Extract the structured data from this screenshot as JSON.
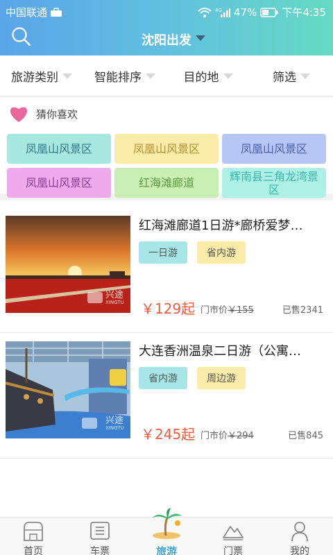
{
  "status": {
    "carrier": "中国联通",
    "battery": "47%",
    "time": "下午4:35"
  },
  "header": {
    "city": "沈阳出发"
  },
  "filters": [
    "旅游类别",
    "智能排序",
    "目的地",
    "筛选"
  ],
  "guess": {
    "title": "猜你喜欢",
    "tags": [
      {
        "label": "凤凰山风景区",
        "bg": "#a8e6e0",
        "color": "#2f7a85"
      },
      {
        "label": "凤凰山风景区",
        "bg": "#fbecaa",
        "color": "#b09030"
      },
      {
        "label": "凤凰山风景区",
        "bg": "#b7c7f5",
        "color": "#4a5ea8"
      },
      {
        "label": "凤凰山风景区",
        "bg": "#eeaaec",
        "color": "#8a3c90"
      },
      {
        "label": "红海滩廊道",
        "bg": "#c8eeb3",
        "color": "#5e9a40"
      },
      {
        "label": "辉南县三角龙湾景区",
        "bg": "#aef0e6",
        "color": "#3ab5aa"
      }
    ]
  },
  "products": [
    {
      "title": "红海滩廊道1日游*廊桥爱梦…",
      "tags": [
        "一日游",
        "省内游"
      ],
      "tag_colors": [
        "#a6e6e6",
        "#fbecaa"
      ],
      "price": "￥129起",
      "market_label": "门市价",
      "market_price": "￥155",
      "sold": "已售2341",
      "watermark": "兴途",
      "watermark_en": "XINGTU"
    },
    {
      "title": "大连香洲温泉二日游（公寓…",
      "tags": [
        "省内游",
        "周边游"
      ],
      "tag_colors": [
        "#a6e6e6",
        "#fbecaa"
      ],
      "price": "￥245起",
      "market_label": "门市价",
      "market_price": "￥294",
      "sold": "已售845",
      "watermark": "兴途",
      "watermark_en": "XINGTU"
    }
  ],
  "tabs": [
    {
      "label": "首页",
      "icon": "home-icon"
    },
    {
      "label": "车票",
      "icon": "ticket-icon"
    },
    {
      "label": "旅游",
      "icon": "palm-island-icon",
      "active": true
    },
    {
      "label": "门票",
      "icon": "mountain-icon"
    },
    {
      "label": "我的",
      "icon": "user-icon"
    }
  ]
}
